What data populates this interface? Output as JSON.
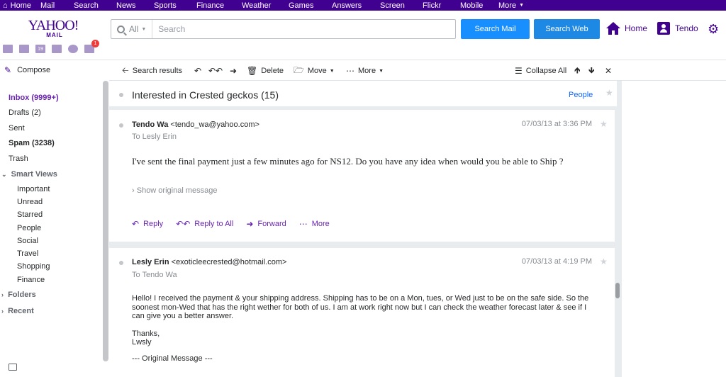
{
  "topnav": {
    "items": [
      {
        "label": "Home"
      },
      {
        "label": "Mail"
      },
      {
        "label": "Search"
      },
      {
        "label": "News"
      },
      {
        "label": "Sports"
      },
      {
        "label": "Finance"
      },
      {
        "label": "Weather"
      },
      {
        "label": "Games"
      },
      {
        "label": "Answers"
      },
      {
        "label": "Screen"
      },
      {
        "label": "Flickr"
      },
      {
        "label": "Mobile"
      },
      {
        "label": "More"
      }
    ]
  },
  "header": {
    "logo_main": "YAHOO!",
    "logo_sub": "MAIL",
    "search_scope": "All",
    "search_placeholder": "Search",
    "search_mail_label": "Search Mail",
    "search_web_label": "Search Web",
    "home_label": "Home",
    "user_label": "Tendo",
    "notification_count": "1",
    "calendar_day": "19"
  },
  "sidebar": {
    "compose_label": "Compose",
    "folders": [
      {
        "label": "Inbox (9999+)"
      },
      {
        "label": "Drafts (2)"
      },
      {
        "label": "Sent"
      },
      {
        "label": "Spam (3238)"
      },
      {
        "label": "Trash"
      }
    ],
    "smart_views_label": "Smart Views",
    "smart_views": [
      {
        "label": "Important"
      },
      {
        "label": "Unread"
      },
      {
        "label": "Starred"
      },
      {
        "label": "People"
      },
      {
        "label": "Social"
      },
      {
        "label": "Travel"
      },
      {
        "label": "Shopping"
      },
      {
        "label": "Finance"
      }
    ],
    "folders_label": "Folders",
    "recent_label": "Recent"
  },
  "toolbar": {
    "back_label": "Search results",
    "delete_label": "Delete",
    "move_label": "Move",
    "more_label": "More",
    "collapse_label": "Collapse All"
  },
  "conversation": {
    "title": "Interested in Crested geckos (15)",
    "people_label": "People"
  },
  "messages": [
    {
      "sender_name": "Tendo Wa",
      "sender_email": "<tendo_wa@yahoo.com>",
      "to": "To  Lesly Erin",
      "date": "07/03/13 at 3:36 PM",
      "body": "I've sent the final payment just a few minutes ago for NS12. Do you have any idea when would you be able to Ship ?",
      "show_original": "Show original message",
      "actions": {
        "reply": "Reply",
        "reply_all": "Reply to All",
        "forward": "Forward",
        "more": "More"
      }
    },
    {
      "sender_name": "Lesly Erin",
      "sender_email": "<exoticleecrested@hotmail.com>",
      "to": "To  Tendo Wa",
      "date": "07/03/13 at 4:19 PM",
      "body_para1": "Hello! I received the payment & your shipping address. Shipping has to be on a Mon, tues, or Wed just to be on the safe side. So the soonest mon-Wed that has the right wether for both of us. I am at work right now but I can check the weather forecast later & see if I can give you a better answer.",
      "body_thanks": "Thanks,",
      "body_sign": "Lwsly",
      "body_orig": "--- Original Message ---"
    }
  ]
}
